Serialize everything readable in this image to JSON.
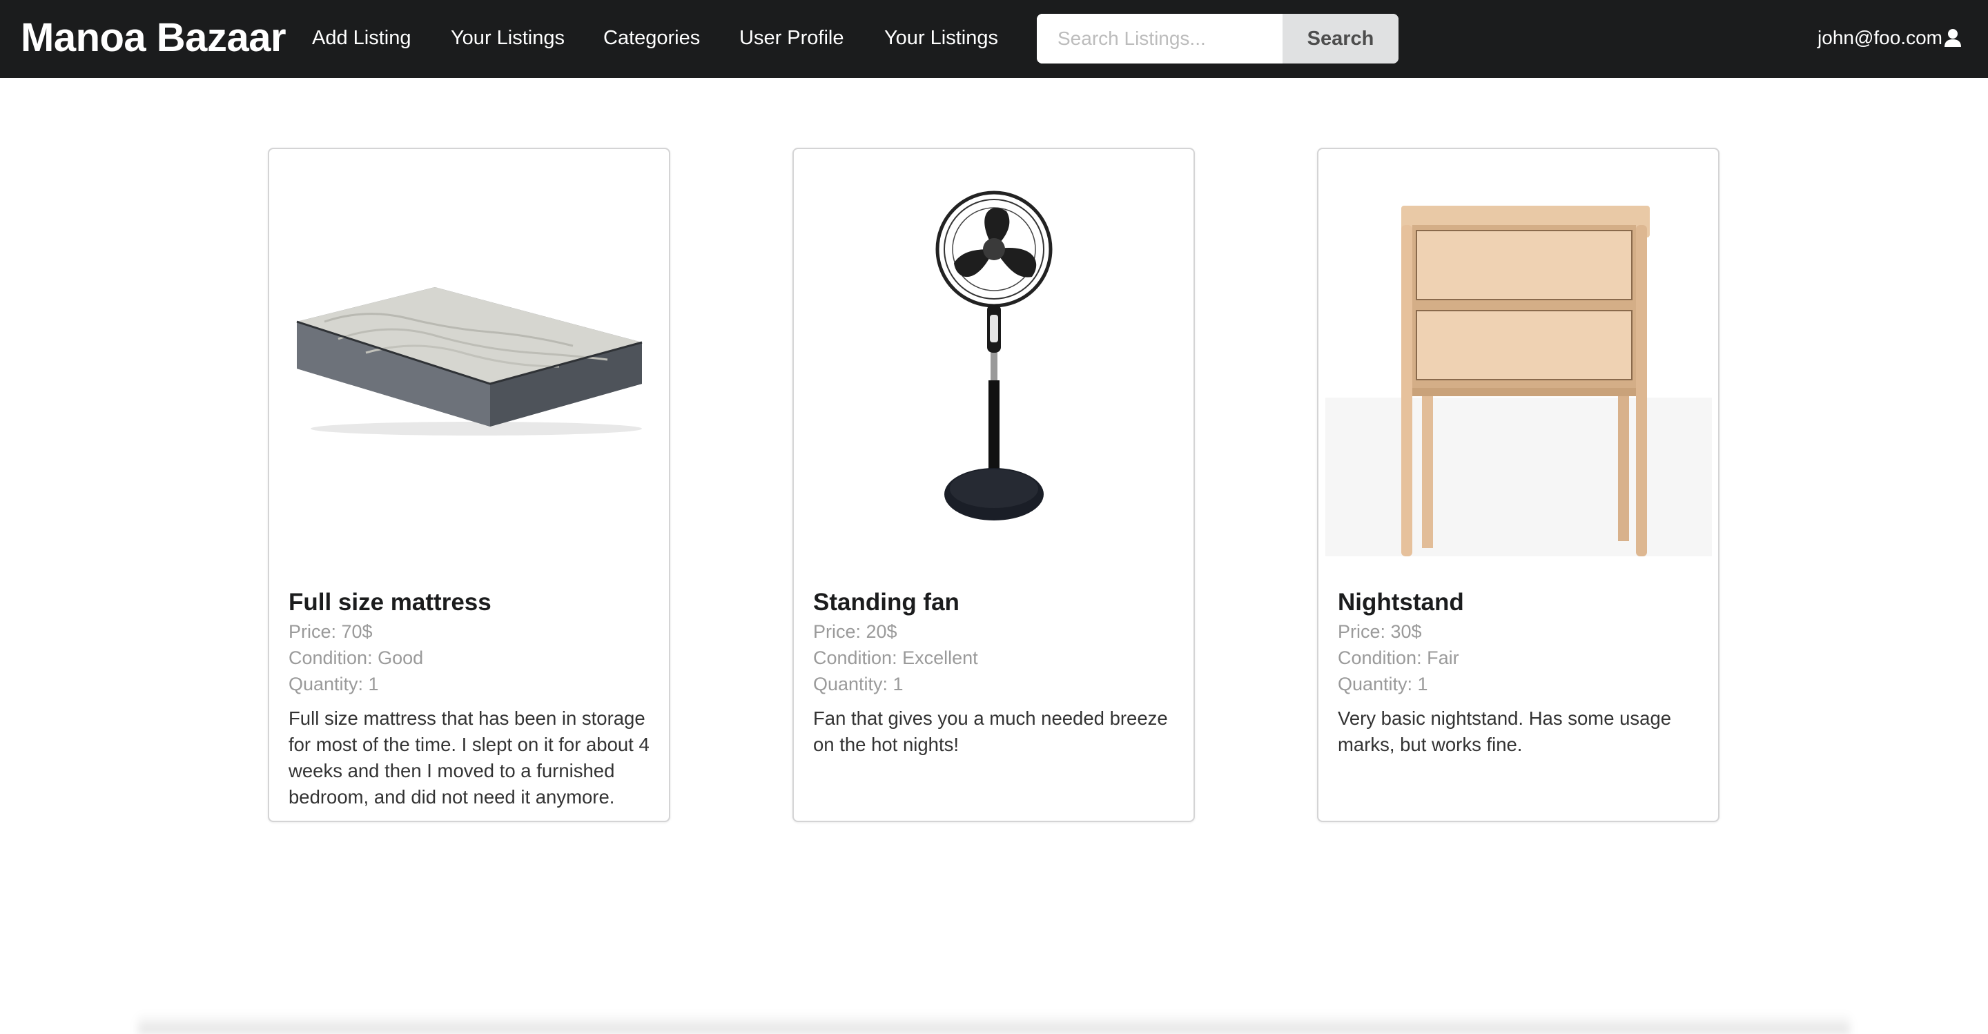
{
  "app": {
    "brand": "Manoa Bazaar"
  },
  "nav": {
    "items": [
      {
        "label": "Add Listing"
      },
      {
        "label": "Your Listings"
      },
      {
        "label": "Categories"
      },
      {
        "label": "User Profile"
      },
      {
        "label": "Your Listings"
      }
    ],
    "search": {
      "placeholder": "Search Listings...",
      "value": "",
      "button_label": "Search"
    },
    "user": {
      "email": "john@foo.com",
      "icon": "user-icon"
    }
  },
  "listings": [
    {
      "title": "Full size mattress",
      "price": "Price: 70$",
      "condition": "Condition: Good",
      "quantity": "Quantity: 1",
      "description": "Full size mattress that has been in storage for most of the time. I slept on it for about 4 weeks and then I moved to a furnished bedroom, and did not need it anymore.",
      "image": "mattress-image"
    },
    {
      "title": "Standing fan",
      "price": "Price: 20$",
      "condition": "Condition: Excellent",
      "quantity": "Quantity: 1",
      "description": "Fan that gives you a much needed breeze on the hot nights!",
      "image": "fan-image"
    },
    {
      "title": "Nightstand",
      "price": "Price: 30$",
      "condition": "Condition: Fair",
      "quantity": "Quantity: 1",
      "description": "Very basic nightstand. Has some usage marks, but works fine.",
      "image": "nightstand-image"
    }
  ],
  "colors": {
    "navbar_bg": "#1b1c1d",
    "search_button_bg": "#e0e1e2",
    "meta_text": "#9a9a9a"
  }
}
